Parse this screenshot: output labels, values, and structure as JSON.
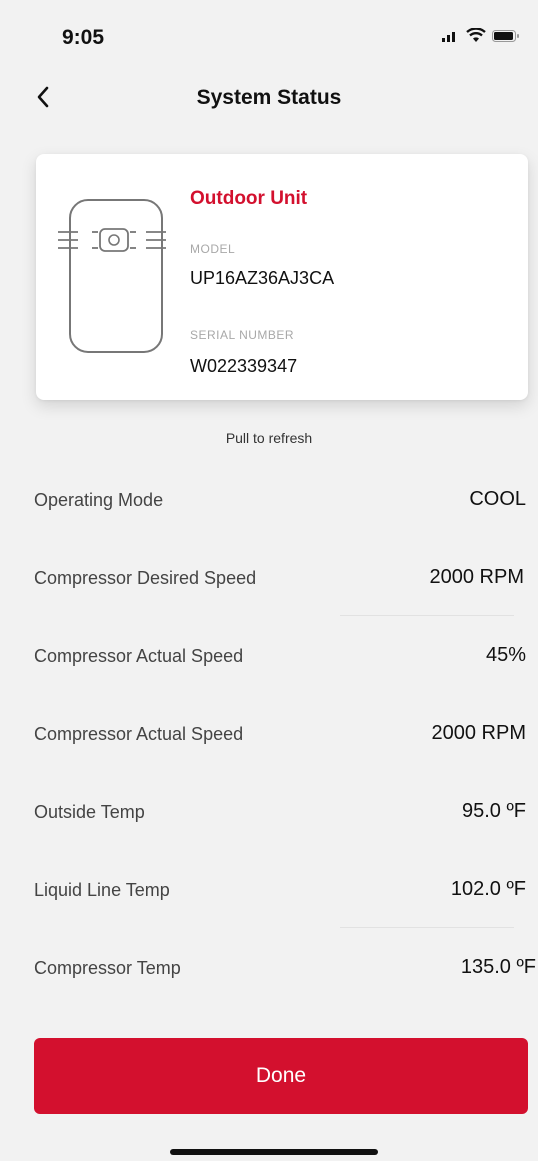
{
  "status_bar": {
    "time": "9:05",
    "icons": [
      "signal-icon",
      "wifi-icon",
      "battery-icon"
    ]
  },
  "nav": {
    "title": "System Status",
    "back_icon": "chevron-left-icon"
  },
  "unit_card": {
    "title": "Outdoor Unit",
    "model_label": "MODEL",
    "model_value": "UP16AZ36AJ3CA",
    "serial_label": "SERIAL NUMBER",
    "serial_value": "W022339347",
    "icon": "outdoor-unit-icon"
  },
  "pull_to_refresh": "Pull to refresh",
  "rows": [
    {
      "label": "Operating Mode",
      "value": "COOL"
    },
    {
      "label": "Compressor Desired Speed",
      "value": "2000 RPM"
    },
    {
      "label": "Compressor Actual Speed",
      "value": "45%"
    },
    {
      "label": "Compressor Actual Speed",
      "value": "2000 RPM"
    },
    {
      "label": "Outside Temp",
      "value": "95.0 ºF"
    },
    {
      "label": "Liquid Line Temp",
      "value": "102.0 ºF"
    },
    {
      "label": "Compressor Temp",
      "value": "135.0 ºF"
    }
  ],
  "done_button": "Done",
  "colors": {
    "accent": "#d3102e",
    "background": "#f2f2f2",
    "card": "#ffffff"
  }
}
